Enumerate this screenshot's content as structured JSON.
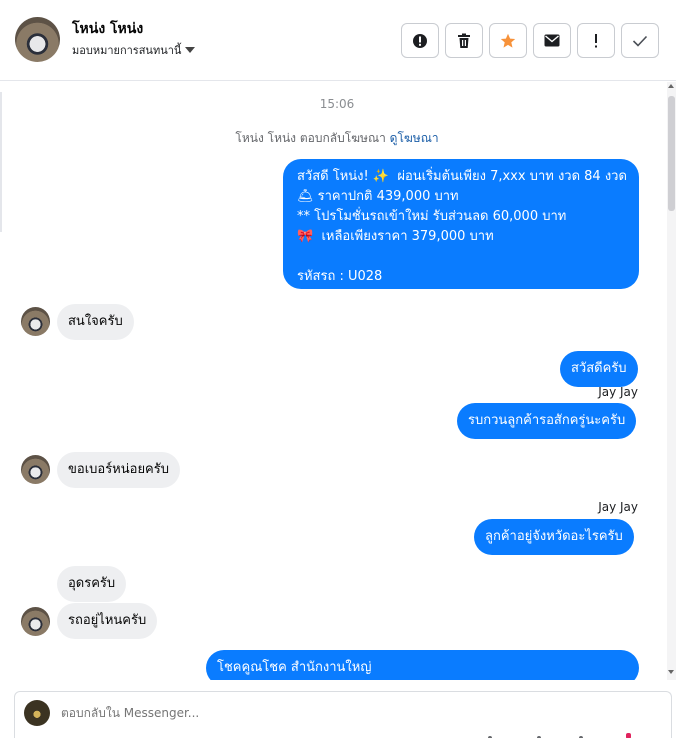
{
  "header": {
    "name": "โหน่ง โหน่ง",
    "subtitle": "มอบหมายการสนทนานี้",
    "actions": [
      "alert-circle-icon",
      "trash-icon",
      "star-icon",
      "envelope-icon",
      "exclamation-icon",
      "check-icon"
    ]
  },
  "conversation": {
    "timestamp": "15:06",
    "notice_text": "โหน่ง โหน่ง ตอบกลับโฆษณา ",
    "notice_link": "ดูโฆษณา",
    "messages": {
      "m1": "สวัสดี โหน่ง! ✨  ผ่อนเริ่มต้นเพียง 7,xxx บาท งวด 84 งวด\n🛎 ราคาปกติ 439,000 บาท\n** โปรโมชั่นรถเข้าใหม่ รับส่วนลด 60,000 บาท\n🎀  เหลือเพียงราคา 379,000 บาท\n\nรหัสรถ : U028",
      "m2": "สนใจครับ",
      "m3": "สวัสดีครับ",
      "m3_sender": "Jay Jay",
      "m4": "รบกวนลูกค้ารอสักครู่นะครับ",
      "m5": "ขอเบอร์หน่อยครับ",
      "m6_sender": "Jay Jay",
      "m6": "ลูกค้าอยู่จังหวัดอะไรครับ",
      "m7": "อุดรครับ",
      "m8": "รถอยู่ไหนครับ",
      "m9": "โชคคูณโชค สำนักงานใหญ่"
    }
  },
  "composer": {
    "placeholder": "ตอบกลับใน Messenger..."
  },
  "colors": {
    "outgoing": "#0a7cff",
    "incoming": "#eeeff1",
    "star": "#f7923a"
  }
}
